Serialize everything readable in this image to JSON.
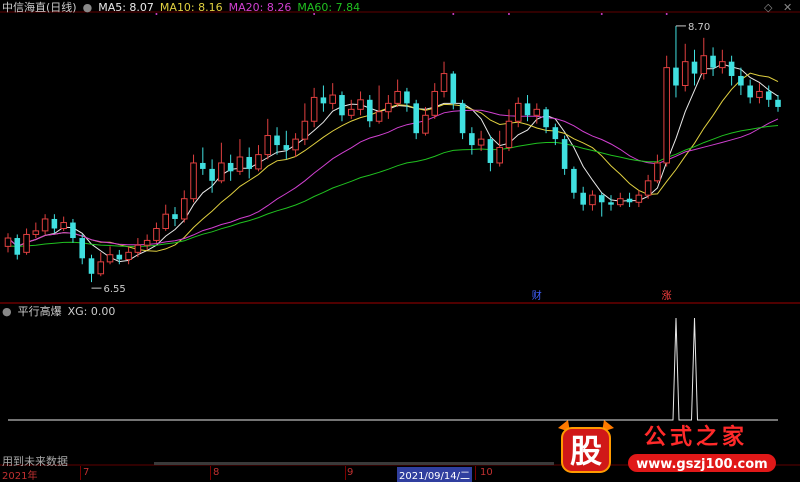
{
  "header": {
    "title": "中信海直(日线)",
    "ma5": "MA5: 8.07",
    "ma10": "MA10: 8.16",
    "ma20": "MA20: 8.26",
    "ma60": "MA60: 7.84",
    "colors": {
      "ma5": "#e8e8e8",
      "ma10": "#e0d040",
      "ma20": "#d040d0",
      "ma60": "#20c020"
    }
  },
  "indicator": {
    "name": "平行高爆",
    "value": "XG: 0.00",
    "note": "用到未来数据"
  },
  "annotations": {
    "high": "8.70",
    "low": "6.55",
    "marker_cai": "财",
    "marker_zhang": "涨"
  },
  "axis": {
    "ticks": [
      "2021年",
      "7",
      "8",
      "9",
      "2021/09/14/二",
      "10"
    ],
    "selected_tick": "2021/09/14/二"
  },
  "watermark": {
    "text1": "股",
    "text2": "公式之家",
    "url": "www.gszj100.com"
  },
  "chart_data": [
    {
      "type": "candlestick",
      "title": "中信海直(日线)",
      "y_range": [
        6.4,
        8.8
      ],
      "high_label": 8.7,
      "low_label": 6.55,
      "colors": {
        "up": "#e04040",
        "down": "#40e0e0"
      },
      "candles": [
        [
          6.85,
          6.92,
          6.96,
          6.8
        ],
        [
          6.92,
          6.78,
          6.95,
          6.74
        ],
        [
          6.8,
          6.95,
          7.0,
          6.78
        ],
        [
          6.95,
          6.98,
          7.05,
          6.92
        ],
        [
          6.98,
          7.08,
          7.12,
          6.95
        ],
        [
          7.08,
          7.0,
          7.12,
          6.96
        ],
        [
          7.0,
          7.05,
          7.1,
          6.98
        ],
        [
          7.05,
          6.92,
          7.08,
          6.88
        ],
        [
          6.92,
          6.75,
          6.95,
          6.7
        ],
        [
          6.75,
          6.62,
          6.78,
          6.55
        ],
        [
          6.62,
          6.72,
          6.8,
          6.6
        ],
        [
          6.72,
          6.78,
          6.85,
          6.7
        ],
        [
          6.78,
          6.74,
          6.82,
          6.7
        ],
        [
          6.74,
          6.8,
          6.85,
          6.7
        ],
        [
          6.8,
          6.86,
          6.92,
          6.76
        ],
        [
          6.86,
          6.9,
          6.95,
          6.82
        ],
        [
          6.9,
          7.0,
          7.05,
          6.88
        ],
        [
          7.0,
          7.12,
          7.2,
          6.98
        ],
        [
          7.12,
          7.08,
          7.18,
          7.02
        ],
        [
          7.08,
          7.25,
          7.32,
          7.05
        ],
        [
          7.25,
          7.55,
          7.62,
          7.22
        ],
        [
          7.55,
          7.5,
          7.68,
          7.45
        ],
        [
          7.5,
          7.4,
          7.58,
          7.3
        ],
        [
          7.4,
          7.55,
          7.72,
          7.38
        ],
        [
          7.55,
          7.48,
          7.62,
          7.4
        ],
        [
          7.48,
          7.6,
          7.75,
          7.45
        ],
        [
          7.6,
          7.5,
          7.68,
          7.42
        ],
        [
          7.5,
          7.62,
          7.7,
          7.48
        ],
        [
          7.62,
          7.78,
          7.92,
          7.58
        ],
        [
          7.78,
          7.7,
          7.85,
          7.62
        ],
        [
          7.7,
          7.66,
          7.82,
          7.58
        ],
        [
          7.66,
          7.75,
          7.8,
          7.6
        ],
        [
          7.75,
          7.9,
          8.05,
          7.7
        ],
        [
          7.9,
          8.1,
          8.18,
          7.85
        ],
        [
          8.1,
          8.05,
          8.2,
          7.98
        ],
        [
          8.05,
          8.12,
          8.22,
          8.0
        ],
        [
          8.12,
          7.95,
          8.15,
          7.9
        ],
        [
          7.95,
          8.0,
          8.08,
          7.92
        ],
        [
          8.0,
          8.08,
          8.15,
          7.95
        ],
        [
          8.08,
          7.9,
          8.12,
          7.85
        ],
        [
          7.9,
          7.98,
          8.2,
          7.88
        ],
        [
          7.98,
          8.05,
          8.12,
          7.92
        ],
        [
          8.05,
          8.15,
          8.25,
          8.02
        ],
        [
          8.15,
          8.05,
          8.18,
          7.98
        ],
        [
          8.05,
          7.8,
          8.08,
          7.75
        ],
        [
          7.8,
          7.95,
          8.02,
          7.78
        ],
        [
          7.95,
          8.15,
          8.22,
          7.92
        ],
        [
          8.15,
          8.3,
          8.4,
          8.1
        ],
        [
          8.3,
          8.05,
          8.32,
          8.0
        ],
        [
          8.05,
          7.8,
          8.08,
          7.75
        ],
        [
          7.8,
          7.7,
          7.85,
          7.62
        ],
        [
          7.7,
          7.75,
          7.82,
          7.65
        ],
        [
          7.75,
          7.55,
          7.78,
          7.48
        ],
        [
          7.55,
          7.68,
          7.82,
          7.52
        ],
        [
          7.68,
          7.9,
          8.0,
          7.65
        ],
        [
          7.9,
          8.05,
          8.1,
          7.85
        ],
        [
          8.05,
          7.95,
          8.12,
          7.9
        ],
        [
          7.95,
          8.0,
          8.05,
          7.88
        ],
        [
          8.0,
          7.85,
          8.02,
          7.8
        ],
        [
          7.85,
          7.75,
          7.88,
          7.7
        ],
        [
          7.75,
          7.5,
          7.78,
          7.45
        ],
        [
          7.5,
          7.3,
          7.52,
          7.25
        ],
        [
          7.3,
          7.2,
          7.35,
          7.15
        ],
        [
          7.2,
          7.28,
          7.32,
          7.15
        ],
        [
          7.28,
          7.22,
          7.3,
          7.1
        ],
        [
          7.22,
          7.2,
          7.28,
          7.15
        ],
        [
          7.2,
          7.25,
          7.3,
          7.18
        ],
        [
          7.25,
          7.22,
          7.3,
          7.18
        ],
        [
          7.22,
          7.28,
          7.32,
          7.18
        ],
        [
          7.28,
          7.4,
          7.45,
          7.25
        ],
        [
          7.4,
          7.55,
          7.62,
          7.38
        ],
        [
          7.55,
          8.35,
          8.45,
          7.52
        ],
        [
          8.35,
          8.2,
          8.7,
          8.1
        ],
        [
          8.2,
          8.4,
          8.55,
          8.15
        ],
        [
          8.4,
          8.3,
          8.5,
          8.2
        ],
        [
          8.3,
          8.45,
          8.6,
          8.25
        ],
        [
          8.45,
          8.35,
          8.52,
          8.28
        ],
        [
          8.35,
          8.4,
          8.5,
          8.3
        ],
        [
          8.4,
          8.28,
          8.45,
          8.2
        ],
        [
          8.28,
          8.2,
          8.35,
          8.12
        ],
        [
          8.2,
          8.1,
          8.25,
          8.05
        ],
        [
          8.1,
          8.15,
          8.22,
          8.05
        ],
        [
          8.15,
          8.08,
          8.2,
          8.02
        ],
        [
          8.08,
          8.02,
          8.12,
          7.98
        ]
      ]
    },
    {
      "type": "line",
      "title": "平行高爆",
      "y_range": [
        0,
        1
      ],
      "series": [
        {
          "name": "XG",
          "value": 0.0
        }
      ],
      "spikes": [
        {
          "index": 72,
          "value": 1
        },
        {
          "index": 74,
          "value": 1
        }
      ]
    }
  ]
}
